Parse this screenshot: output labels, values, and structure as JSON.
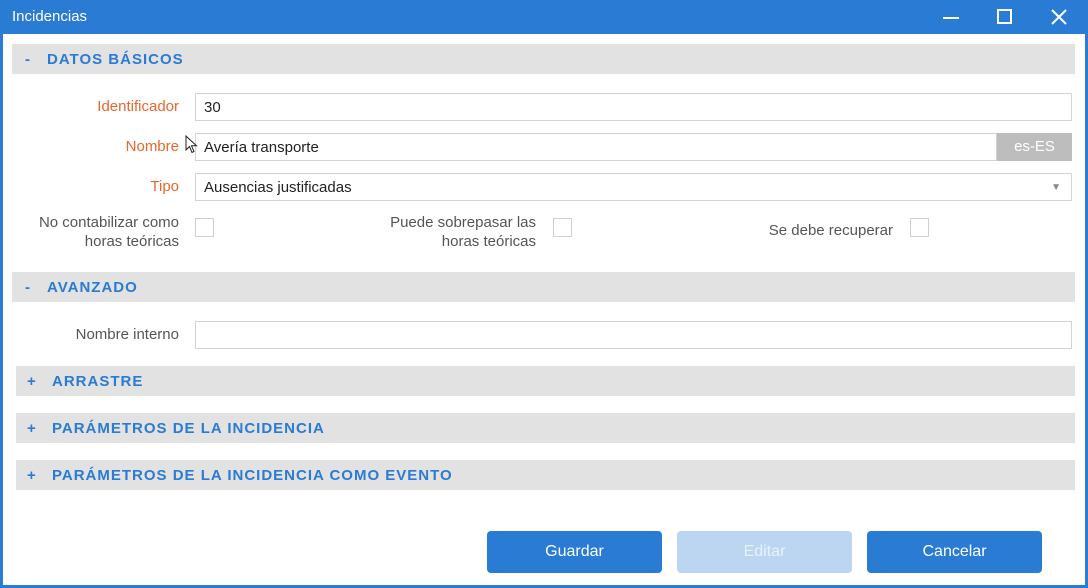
{
  "window": {
    "title": "Incidencias"
  },
  "sections": {
    "basic": {
      "sign": "-",
      "label": "DATOS BÁSICOS"
    },
    "advanced": {
      "sign": "-",
      "label": "AVANZADO"
    },
    "drag": {
      "sign": "+",
      "label": "ARRASTRE"
    },
    "params": {
      "sign": "+",
      "label": "PARÁMETROS DE LA INCIDENCIA"
    },
    "params_event": {
      "sign": "+",
      "label": "PARÁMETROS DE LA INCIDENCIA COMO EVENTO"
    }
  },
  "form": {
    "identifier": {
      "label": "Identificador",
      "value": "30"
    },
    "name": {
      "label": "Nombre",
      "value": "Avería transporte",
      "lang": "es-ES"
    },
    "type": {
      "label": "Tipo",
      "value": "Ausencias justificadas"
    },
    "no_count": {
      "label_line1": "No contabilizar como",
      "label_line2": "horas teóricas",
      "checked": false
    },
    "can_exceed": {
      "label_line1": "Puede sobrepasar las",
      "label_line2": "horas teóricas",
      "checked": false
    },
    "must_recover": {
      "label": "Se debe recuperar",
      "checked": false
    },
    "internal_name": {
      "label": "Nombre interno",
      "value": ""
    }
  },
  "buttons": {
    "save": "Guardar",
    "edit": "Editar",
    "cancel": "Cancelar"
  },
  "colors": {
    "accent": "#2a7bd4",
    "required": "#e8662c",
    "section_bg": "#e2e2e2",
    "disabled": "#bcd6f1"
  }
}
